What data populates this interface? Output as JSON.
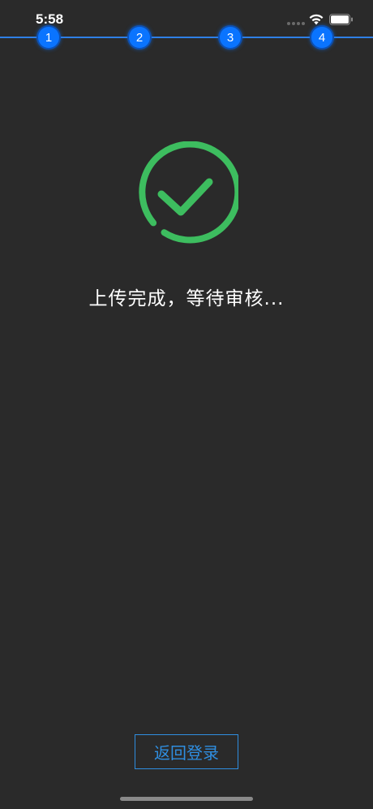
{
  "status_bar": {
    "time": "5:58",
    "wifi_icon": "wifi-icon",
    "battery_icon": "battery-icon"
  },
  "steps": [
    {
      "label": "1"
    },
    {
      "label": "2"
    },
    {
      "label": "3"
    },
    {
      "label": "4"
    }
  ],
  "success": {
    "icon": "check-circle-icon",
    "color": "#3dbd5f",
    "message": "上传完成，等待审核..."
  },
  "actions": {
    "back_to_login_label": "返回登录",
    "accent_color": "#2f8ee0"
  },
  "theme": {
    "background": "#2a2a2a",
    "step_color": "#0a74ff"
  }
}
